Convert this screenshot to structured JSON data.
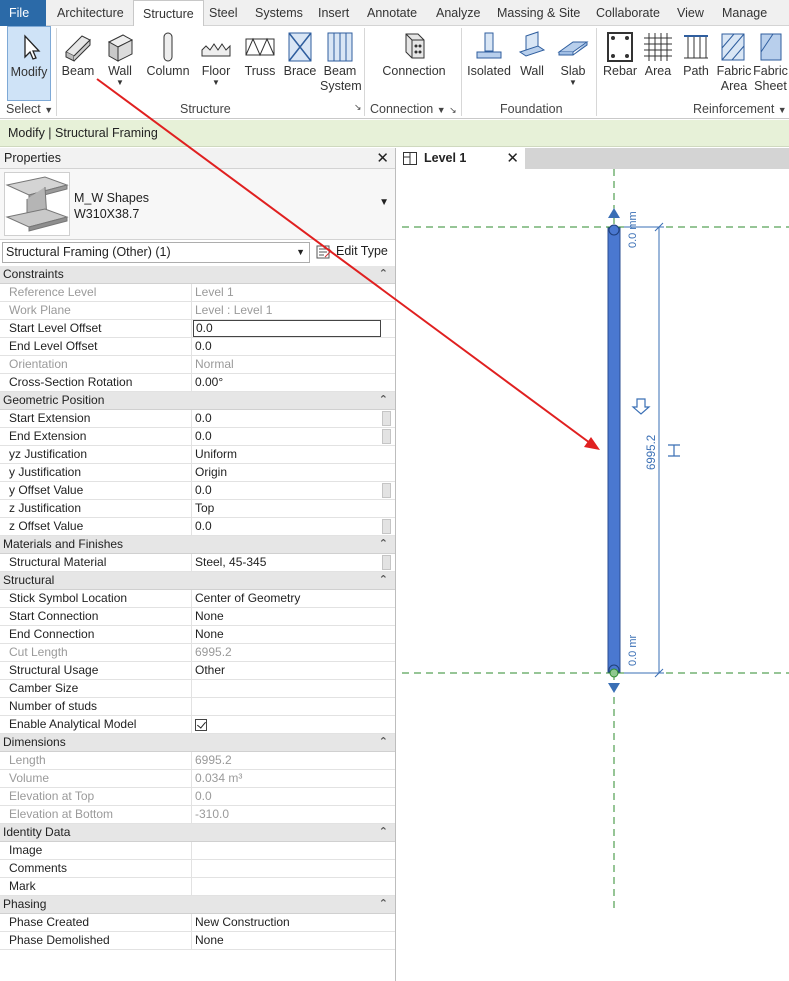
{
  "menu": {
    "tabs": [
      "File",
      "Architecture",
      "Structure",
      "Steel",
      "Systems",
      "Insert",
      "Annotate",
      "Analyze",
      "Massing & Site",
      "Collaborate",
      "View",
      "Manage"
    ],
    "active": "Structure"
  },
  "ribbon": {
    "buttons": {
      "modify": "Modify",
      "beam": "Beam",
      "wall": "Wall",
      "column": "Column",
      "floor": "Floor",
      "truss": "Truss",
      "brace": "Brace",
      "beam_system_1": "Beam",
      "beam_system_2": "System",
      "connection": "Connection",
      "isolated": "Isolated",
      "fwall": "Wall",
      "slab": "Slab",
      "rebar": "Rebar",
      "area": "Area",
      "path": "Path",
      "fabric_area_1": "Fabric",
      "fabric_area_2": "Area",
      "fabric_sheet_1": "Fabric",
      "fabric_sheet_2": "Sheet"
    },
    "panels": {
      "select": "Select",
      "structure": "Structure",
      "connection": "Connection",
      "foundation": "Foundation",
      "reinforcement": "Reinforcement"
    }
  },
  "context_bar": "Modify | Structural Framing",
  "properties": {
    "title": "Properties",
    "type_family": "M_W Shapes",
    "type_name": "W310X38.7",
    "instance_filter": "Structural Framing (Other) (1)",
    "edit_type": "Edit Type",
    "groups": {
      "constraints": "Constraints",
      "geometric": "Geometric Position",
      "materials": "Materials and Finishes",
      "structural": "Structural",
      "dimensions": "Dimensions",
      "identity": "Identity Data",
      "phasing": "Phasing"
    },
    "rows": {
      "reference_level": {
        "k": "Reference Level",
        "v": "Level 1"
      },
      "work_plane": {
        "k": "Work Plane",
        "v": "Level : Level 1"
      },
      "start_level_offset": {
        "k": "Start Level Offset",
        "v": "0.0"
      },
      "end_level_offset": {
        "k": "End Level Offset",
        "v": "0.0"
      },
      "orientation": {
        "k": "Orientation",
        "v": "Normal"
      },
      "cross_section_rotation": {
        "k": "Cross-Section Rotation",
        "v": "0.00°"
      },
      "start_extension": {
        "k": "Start Extension",
        "v": "0.0"
      },
      "end_extension": {
        "k": "End Extension",
        "v": "0.0"
      },
      "yz_justification": {
        "k": "yz Justification",
        "v": "Uniform"
      },
      "y_justification": {
        "k": "y Justification",
        "v": "Origin"
      },
      "y_offset_value": {
        "k": "y Offset Value",
        "v": "0.0"
      },
      "z_justification": {
        "k": "z Justification",
        "v": "Top"
      },
      "z_offset_value": {
        "k": "z Offset Value",
        "v": "0.0"
      },
      "structural_material": {
        "k": "Structural Material",
        "v": "Steel, 45-345"
      },
      "stick_symbol_location": {
        "k": "Stick Symbol Location",
        "v": "Center of Geometry"
      },
      "start_connection": {
        "k": "Start Connection",
        "v": "None"
      },
      "end_connection": {
        "k": "End Connection",
        "v": "None"
      },
      "cut_length": {
        "k": "Cut Length",
        "v": "6995.2"
      },
      "structural_usage": {
        "k": "Structural Usage",
        "v": "Other"
      },
      "camber_size": {
        "k": "Camber Size",
        "v": ""
      },
      "number_of_studs": {
        "k": "Number of studs",
        "v": ""
      },
      "enable_analytical_model": {
        "k": "Enable Analytical Model",
        "v": ""
      },
      "length": {
        "k": "Length",
        "v": "6995.2"
      },
      "volume": {
        "k": "Volume",
        "v": "0.034 m³"
      },
      "elevation_at_top": {
        "k": "Elevation at Top",
        "v": "0.0"
      },
      "elevation_at_bottom": {
        "k": "Elevation at Bottom",
        "v": "-310.0"
      },
      "image": {
        "k": "Image",
        "v": ""
      },
      "comments": {
        "k": "Comments",
        "v": ""
      },
      "mark": {
        "k": "Mark",
        "v": ""
      },
      "phase_created": {
        "k": "Phase Created",
        "v": "New Construction"
      },
      "phase_demolished": {
        "k": "Phase Demolished",
        "v": "None"
      }
    }
  },
  "view": {
    "tab_label": "Level 1",
    "dim_top": "0.0 mm",
    "dim_bottom": "0.0 mr",
    "dim_length": "6995.2"
  },
  "colors": {
    "beam": "#4a78d0",
    "gridline": "#2e8b2e",
    "dimension": "#3a6fb5",
    "annotation_arrow": "#e02020",
    "file_tab": "#2b6aa8"
  }
}
